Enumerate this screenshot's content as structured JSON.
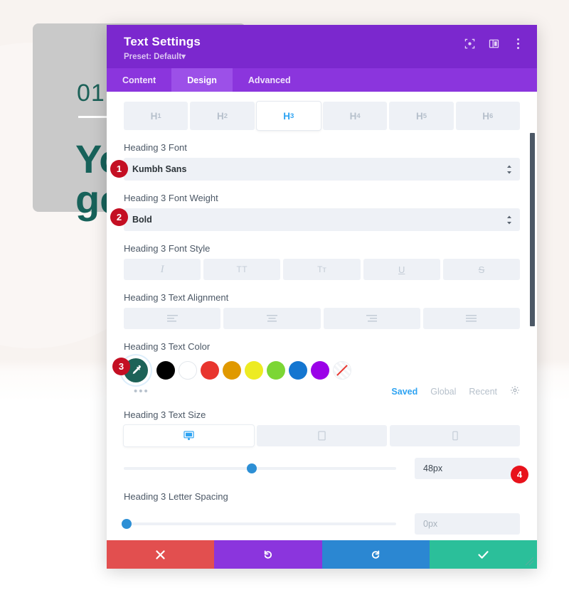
{
  "background": {
    "number": "01",
    "heading_line1": "Yo",
    "heading_line2": "ge",
    "heading_color": "#17625a",
    "card_color": "#c9c9c9",
    "page_color": "#f8f3f0"
  },
  "modal": {
    "title": "Text Settings",
    "preset_label": "Preset: Default",
    "preset_caret": "▾",
    "header_color": "#7b28ce",
    "tabs_color": "#8b35dd",
    "header_icons": [
      {
        "name": "fullscreen-icon",
        "glyph": "⧉"
      },
      {
        "name": "layout-split-icon",
        "glyph": "◫"
      },
      {
        "name": "more-vertical-icon",
        "glyph": "⋮"
      }
    ],
    "tabs": [
      {
        "label": "Content",
        "active": false
      },
      {
        "label": "Design",
        "active": true
      },
      {
        "label": "Advanced",
        "active": false
      }
    ],
    "heading_levels": [
      {
        "label": "H",
        "sub": "1",
        "active": false
      },
      {
        "label": "H",
        "sub": "2",
        "active": false
      },
      {
        "label": "H",
        "sub": "3",
        "active": true
      },
      {
        "label": "H",
        "sub": "4",
        "active": false
      },
      {
        "label": "H",
        "sub": "5",
        "active": false
      },
      {
        "label": "H",
        "sub": "6",
        "active": false
      }
    ],
    "fields": {
      "font": {
        "label": "Heading 3 Font",
        "value": "Kumbh Sans"
      },
      "font_weight": {
        "label": "Heading 3 Font Weight",
        "value": "Bold"
      },
      "font_style": {
        "label": "Heading 3 Font Style",
        "options": [
          {
            "name": "italic-button",
            "glyph": "I"
          },
          {
            "name": "uppercase-button",
            "glyph": "TT"
          },
          {
            "name": "small-caps-button",
            "glyph": "Tᴛ"
          },
          {
            "name": "underline-button",
            "glyph": "U"
          },
          {
            "name": "strikethrough-button",
            "glyph": "S"
          }
        ]
      },
      "text_alignment": {
        "label": "Heading 3 Text Alignment",
        "options": [
          {
            "name": "align-left-button"
          },
          {
            "name": "align-center-button"
          },
          {
            "name": "align-right-button"
          },
          {
            "name": "align-justify-button"
          }
        ]
      },
      "text_color": {
        "label": "Heading 3 Text Color",
        "selected_color": "#1d6257",
        "eyedropper_glyph": "✒",
        "swatches": [
          {
            "name": "swatch-black",
            "color": "#000000"
          },
          {
            "name": "swatch-white",
            "color": "#ffffff"
          },
          {
            "name": "swatch-red",
            "color": "#e8352e"
          },
          {
            "name": "swatch-orange",
            "color": "#e09900"
          },
          {
            "name": "swatch-yellow",
            "color": "#edeb22"
          },
          {
            "name": "swatch-green",
            "color": "#7cd635"
          },
          {
            "name": "swatch-blue",
            "color": "#1476d0"
          },
          {
            "name": "swatch-purple",
            "color": "#9b01e8"
          },
          {
            "name": "swatch-transparent",
            "color": "transparent"
          }
        ],
        "more_glyph": "•••",
        "palette_tabs": [
          {
            "label": "Saved",
            "active": true
          },
          {
            "label": "Global",
            "active": false
          },
          {
            "label": "Recent",
            "active": false
          }
        ],
        "settings_icon": "gear-icon"
      },
      "text_size": {
        "label": "Heading 3 Text Size",
        "devices": [
          {
            "name": "device-desktop",
            "active": true
          },
          {
            "name": "device-tablet",
            "active": false
          },
          {
            "name": "device-phone",
            "active": false
          }
        ],
        "value": "48px",
        "slider_percent": 47
      },
      "letter_spacing": {
        "label": "Heading 3 Letter Spacing",
        "value": "0px",
        "slider_percent": 1
      }
    },
    "footer": [
      {
        "name": "cancel-button",
        "glyph": "✖",
        "color": "#e24f4f"
      },
      {
        "name": "undo-button",
        "glyph": "↺",
        "color": "#8b35dd"
      },
      {
        "name": "redo-button",
        "glyph": "↻",
        "color": "#2b87d2"
      },
      {
        "name": "save-button",
        "glyph": "✔",
        "color": "#2bbf9a"
      }
    ]
  },
  "badges": [
    {
      "number": "1",
      "style": "dark"
    },
    {
      "number": "2",
      "style": "dark"
    },
    {
      "number": "3",
      "style": "dark"
    },
    {
      "number": "4",
      "style": "bright"
    }
  ]
}
